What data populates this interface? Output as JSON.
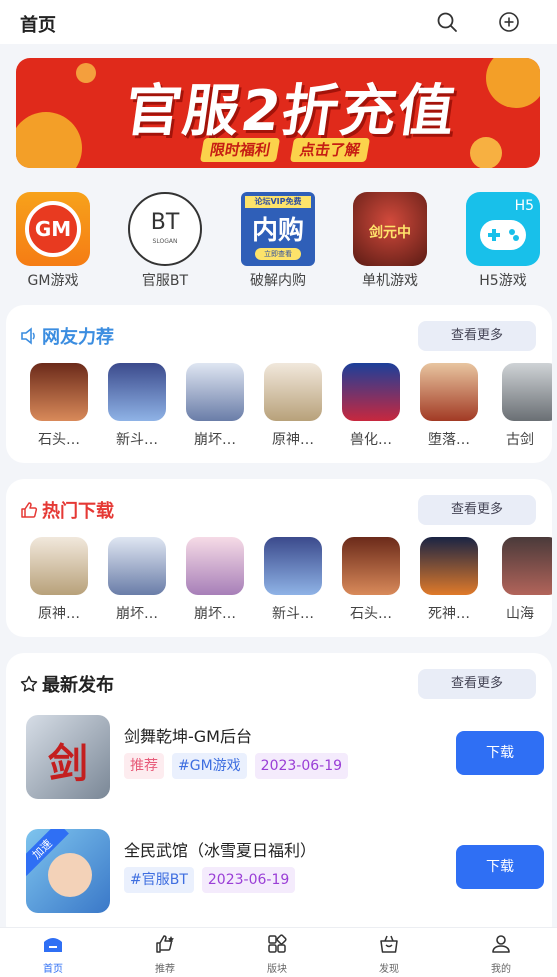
{
  "header": {
    "title": "首页"
  },
  "banner": {
    "main": "官服2折充值",
    "sub_left": "限时福利",
    "sub_right": "点击了解"
  },
  "categories": [
    {
      "label": "GM游戏",
      "icon_text": "GM"
    },
    {
      "label": "官服BT",
      "icon_text": "BT",
      "icon_sub": "SLOGAN"
    },
    {
      "label": "破解内购",
      "icon_text": "内购",
      "icon_badge": "论坛VIP免费",
      "icon_btn": "立即查看"
    },
    {
      "label": "单机游戏",
      "icon_text": "剑元中"
    },
    {
      "label": "H5游戏",
      "icon_text": "H5"
    }
  ],
  "recommend": {
    "title": "网友力荐",
    "more": "查看更多",
    "items": [
      "石头…",
      "新斗…",
      "崩坏…",
      "原神…",
      "兽化…",
      "堕落…",
      "古剑"
    ]
  },
  "hot": {
    "title": "热门下载",
    "more": "查看更多",
    "items": [
      "原神…",
      "崩坏…",
      "崩坏…",
      "新斗…",
      "石头…",
      "死神…",
      "山海"
    ]
  },
  "latest": {
    "title": "最新发布",
    "more": "查看更多",
    "items": [
      {
        "name": "剑舞乾坤-GM后台",
        "tags": [
          "推荐",
          "#GM游戏",
          "2023-06-19"
        ],
        "button": "下载",
        "icon_text": "剑"
      },
      {
        "name": "全民武馆（冰雪夏日福利）",
        "tags": [
          "#官服BT",
          "2023-06-19"
        ],
        "button": "下载",
        "icon_text": "加速"
      }
    ]
  },
  "tabs": [
    {
      "label": "首页",
      "active": true
    },
    {
      "label": "推荐",
      "active": false
    },
    {
      "label": "版块",
      "active": false
    },
    {
      "label": "发现",
      "active": false
    },
    {
      "label": "我的",
      "active": false
    }
  ],
  "colors": {
    "accent": "#2f6ff4",
    "hot_red": "#e53935",
    "recommend_blue": "#3b8de0",
    "banner_red": "#e02a1b"
  }
}
